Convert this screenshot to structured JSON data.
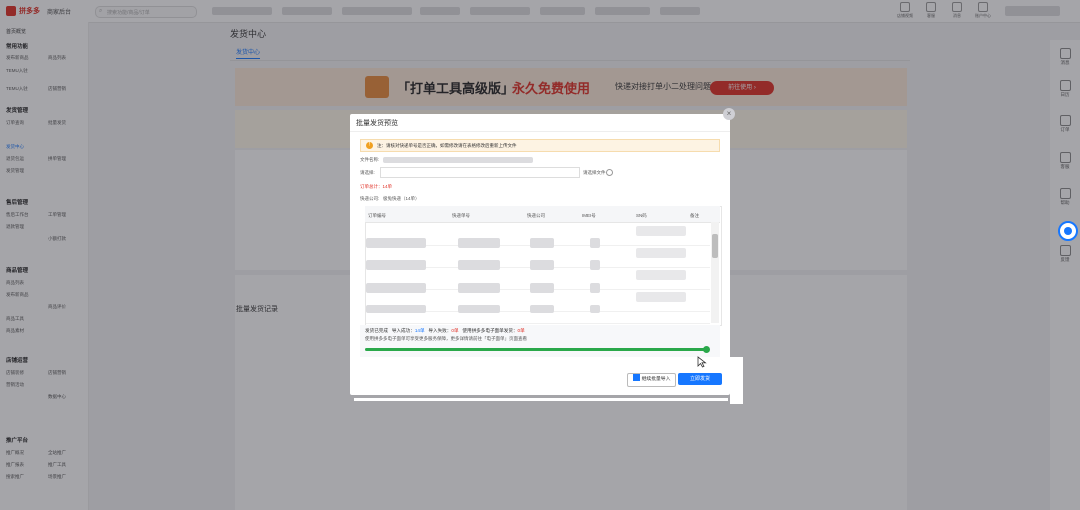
{
  "topbar": {
    "logo_text": "拼多多",
    "logo_sub": "商家后台",
    "search_placeholder": "搜索功能/商品/订单",
    "icons": [
      "店铺视频",
      "客服",
      "消息",
      "账户中心"
    ]
  },
  "sidebar": {
    "home": "首页概览",
    "sections": [
      {
        "title": "常用功能",
        "items": [
          "发布新商品",
          "商品列表",
          "TEMU入驻",
          "店铺营销"
        ]
      },
      {
        "title": "发货管理",
        "items": [
          "订单查询",
          "发货中心",
          "批量发货",
          "退货包运",
          "拼单管理",
          "发货管理"
        ]
      },
      {
        "title": "售后管理",
        "items": [
          "售后工作台",
          "工单管理",
          "退款管理",
          "小额打款"
        ]
      },
      {
        "title": "商品管理",
        "items": [
          "商品列表",
          "发布新商品",
          "商品评价",
          "商品工具",
          "商品素材"
        ]
      },
      {
        "title": "店铺运营",
        "items": [
          "店铺装修",
          "店铺营销",
          "营销活动",
          "数据中心"
        ]
      },
      {
        "title": "推广平台",
        "items": [
          "推广概况",
          "全站推广",
          "推广报表",
          "推广工具",
          "搜索推广",
          "场景推广"
        ]
      }
    ]
  },
  "main": {
    "title": "发货中心",
    "tab": "发货中心",
    "banner": {
      "title": "「打单工具高级版」",
      "highlight": "永久免费使用",
      "subtitle": "快递对接打单小二处理问题",
      "button": "前往使用 ›"
    },
    "bottom_title": "批量发货记录"
  },
  "modal": {
    "title": "批量发货预览",
    "close": "×",
    "notice": "注：请核对快递单号是否正确，如需修改请在表格修改后重新上传文件",
    "file_label": "文件名称:",
    "upload_label": "请选择:",
    "upload_hint": "请选择文件",
    "order_total_label": "订单总计：",
    "order_total": "14单",
    "courier_label": "快递公司:",
    "courier_value": "极兔快递（14单）",
    "columns": [
      "订单编号",
      "快递单号",
      "快递公司",
      "IMEI号",
      "SN码",
      "备注"
    ],
    "result_line": {
      "prefix": "发货已完成",
      "import_label": "导入成功",
      "import_value": "14单",
      "fail_label": "导入失败",
      "fail_value": "0单",
      "ship_label": "使用拼多多电子面单发货",
      "ship_value": "0单"
    },
    "result_note": "使用拼多多电子面单可享受更多服务保障，更多详情请前往「电子面单」页面查看",
    "progress": 1.0,
    "continue_button": "继续批量导入",
    "send_button": "立即发货"
  },
  "right_rail": [
    "消息",
    "日历",
    "订单",
    "客服",
    "帮助",
    "反馈"
  ],
  "colors": {
    "brand": "#e02e24",
    "accent": "#1677ff",
    "success": "#2aa84a"
  }
}
